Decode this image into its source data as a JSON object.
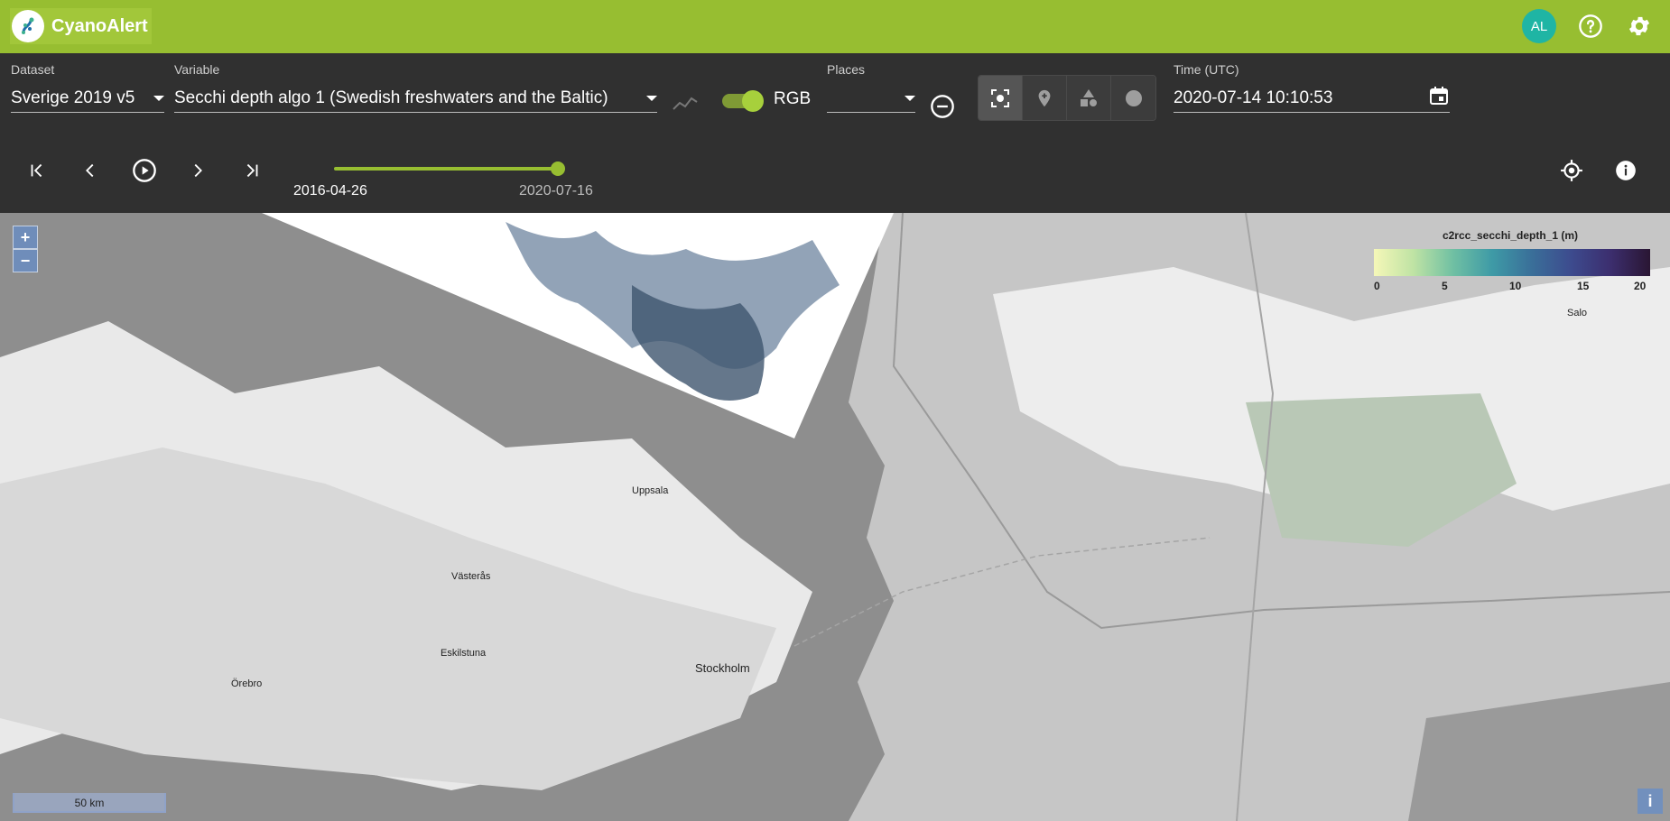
{
  "app": {
    "name": "CyanoAlert",
    "avatar_initials": "AL"
  },
  "controls": {
    "dataset": {
      "label": "Dataset",
      "value": "Sverige 2019 v5"
    },
    "variable": {
      "label": "Variable",
      "value": "Secchi depth algo 1 (Swedish freshwaters and the Baltic)"
    },
    "rgb_label": "RGB",
    "rgb_enabled": true,
    "places": {
      "label": "Places",
      "value": ""
    },
    "time": {
      "label": "Time (UTC)",
      "value": "2020-07-14 10:10:53"
    }
  },
  "timeline": {
    "start": "2016-04-26",
    "end": "2020-07-16",
    "position": 1.0
  },
  "map": {
    "zoom_in": "+",
    "zoom_out": "−",
    "scalebar": "50 km",
    "attribution": "i",
    "legend": {
      "title": "c2rcc_secchi_depth_1 (m)",
      "ticks": [
        "0",
        "5",
        "10",
        "15",
        "20"
      ],
      "min": 0,
      "max": 20
    },
    "places": [
      "Uppsala",
      "Västerås",
      "Eskilstuna",
      "Örebro",
      "Stockholm",
      "Salo"
    ]
  },
  "colors": {
    "header": "#97be31",
    "accent": "#97be31",
    "avatar": "#1fb5a4",
    "toolbar": "#303030"
  }
}
